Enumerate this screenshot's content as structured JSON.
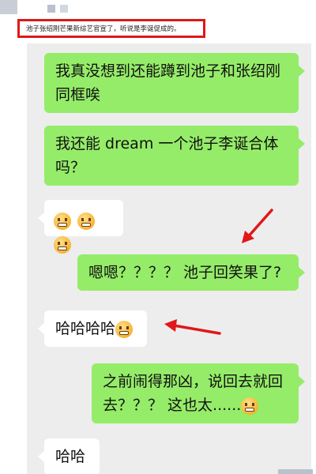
{
  "caption": "池子张绍刚芒果新综艺官宣了，听说是李诞促成的。",
  "messages": [
    {
      "side": "right",
      "text": "我真没想到还能蹲到池子和张绍刚同框唉"
    },
    {
      "side": "right",
      "text": "我还能 dream 一个池子李诞合体吗？"
    },
    {
      "side": "left",
      "emoji": [
        "grimace-icon",
        "grimace-icon",
        "grimace-icon"
      ]
    },
    {
      "side": "right",
      "text": "嗯嗯？？？？ 池子回笑果了?"
    },
    {
      "side": "left",
      "text": "哈哈哈哈",
      "emoji": [
        "grimace-icon"
      ]
    },
    {
      "side": "right",
      "text": "之前闹得那凶，说回去就回去？？？ 这也太......",
      "emoji": [
        "sweat-icon"
      ]
    },
    {
      "side": "left",
      "text": "哈哈"
    }
  ],
  "colors": {
    "highlight_border": "#e01818",
    "annotation_arrow": "#e01818",
    "bubble_green": "#95ec69",
    "bubble_white": "#ffffff",
    "chat_bg": "#ededed"
  }
}
